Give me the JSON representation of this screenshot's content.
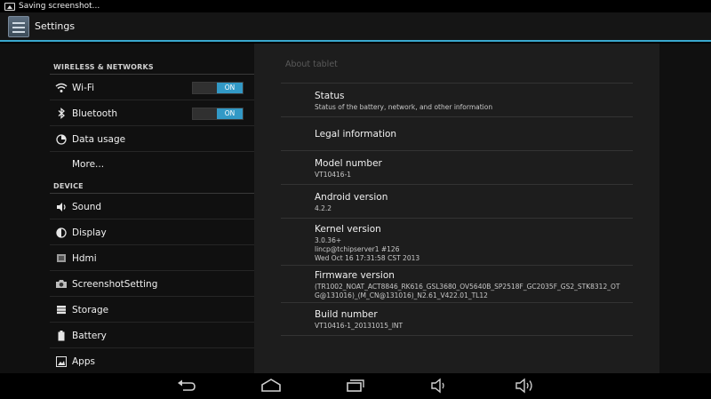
{
  "status_bar": {
    "notification": "Saving screenshot..."
  },
  "action_bar": {
    "title": "Settings"
  },
  "left_pane": {
    "sections": [
      {
        "header": "WIRELESS & NETWORKS"
      },
      {
        "header": "DEVICE"
      }
    ],
    "items": [
      {
        "label": "Wi-Fi",
        "icon": "wifi-icon",
        "toggle": "ON"
      },
      {
        "label": "Bluetooth",
        "icon": "bluetooth-icon",
        "toggle": "ON"
      },
      {
        "label": "Data usage",
        "icon": "data-usage-icon"
      },
      {
        "label": "More..."
      },
      {
        "label": "Sound",
        "icon": "speaker-icon"
      },
      {
        "label": "Display",
        "icon": "display-icon"
      },
      {
        "label": "Hdmi",
        "icon": "hdmi-icon"
      },
      {
        "label": "ScreenshotSetting",
        "icon": "camera-icon"
      },
      {
        "label": "Storage",
        "icon": "storage-icon"
      },
      {
        "label": "Battery",
        "icon": "battery-icon"
      },
      {
        "label": "Apps",
        "icon": "apps-icon"
      }
    ]
  },
  "right_pane": {
    "title": "About tablet",
    "prefs": [
      {
        "title": "Status",
        "summary": "Status of the battery, network, and other information"
      },
      {
        "title": "Legal information",
        "summary": ""
      },
      {
        "title": "Model number",
        "summary": "VT10416-1"
      },
      {
        "title": "Android version",
        "summary": "4.2.2"
      },
      {
        "title": "Kernel version",
        "summary_lines": [
          "3.0.36+",
          "lincp@tchipserver1 #126",
          "Wed Oct 16 17:31:58 CST 2013"
        ]
      },
      {
        "title": "Firmware version",
        "summary_lines": [
          "(TR1002_NOAT_ACT8846_RK616_GSL3680_OV5640B_SP2518F_GC2035F_GS2_STK8312_OT",
          "G@131016)_(M_CN@131016)_N2.61_V422.01_TL12"
        ]
      },
      {
        "title": "Build number",
        "summary": "VT10416-1_20131015_INT"
      }
    ]
  },
  "nav_bar": {
    "buttons": [
      "back-icon",
      "home-icon",
      "recent-apps-icon",
      "volume-down-icon",
      "volume-up-icon"
    ]
  },
  "colors": {
    "accent": "#3aa9cf",
    "toggle_on": "#3299c6"
  }
}
